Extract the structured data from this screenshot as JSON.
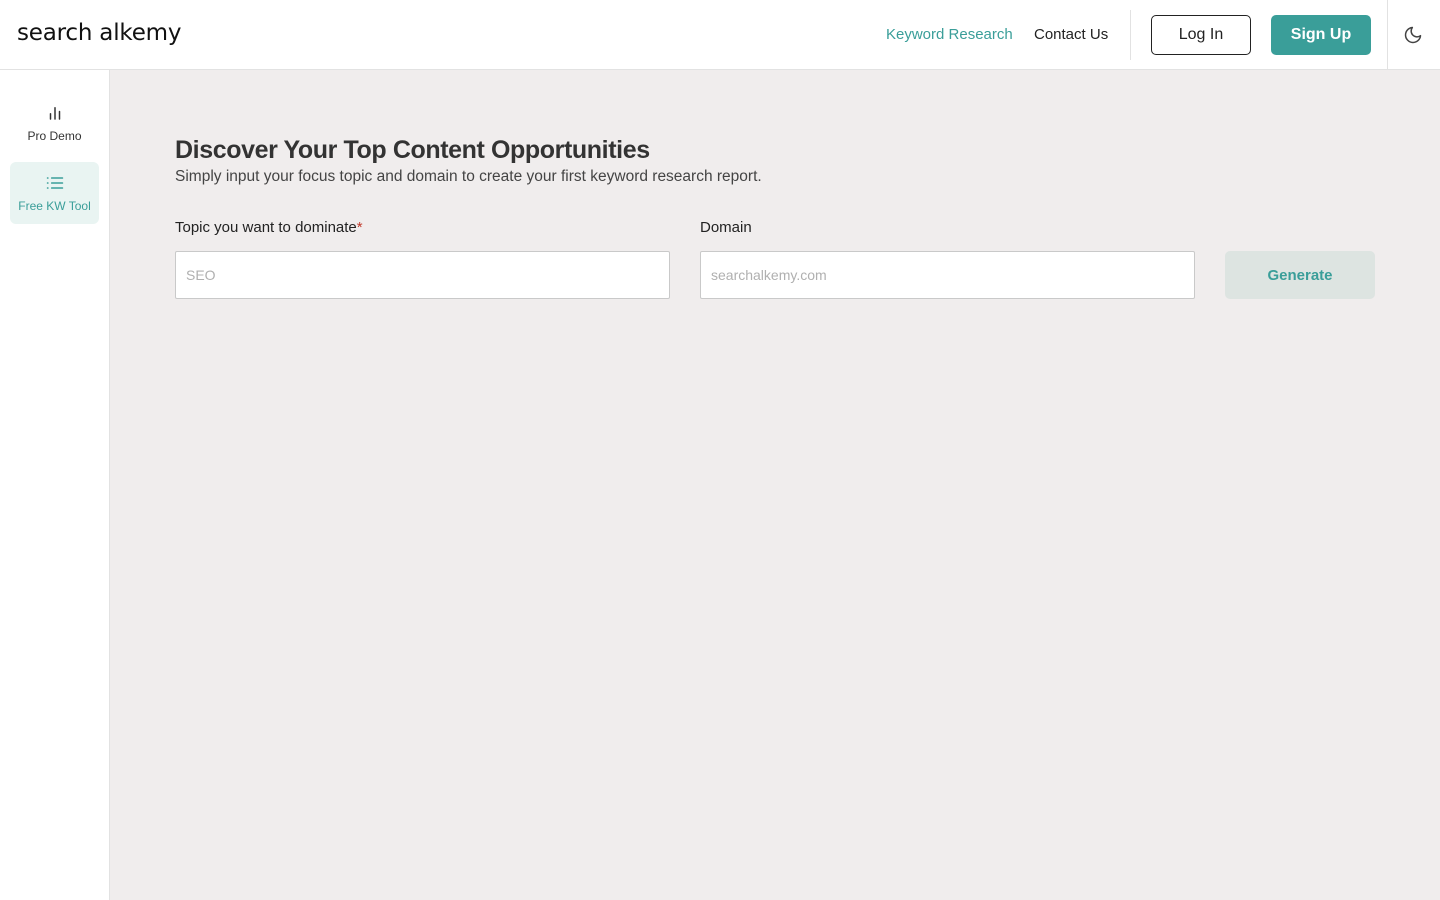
{
  "header": {
    "logo": "search alkemy",
    "nav": {
      "keyword_research": "Keyword Research",
      "contact_us": "Contact Us"
    },
    "login_label": "Log In",
    "signup_label": "Sign Up",
    "theme_icon": "moon-icon"
  },
  "sidebar": {
    "items": [
      {
        "label": "Pro Demo",
        "icon": "bar-chart-icon",
        "active": false
      },
      {
        "label": "Free KW Tool",
        "icon": "list-icon",
        "active": true
      }
    ]
  },
  "main": {
    "title": "Discover Your Top Content Opportunities",
    "subtitle": "Simply input your focus topic and domain to create your first keyword research report.",
    "topic_field": {
      "label": "Topic you want to dominate",
      "required_marker": "*",
      "value": "",
      "placeholder": "SEO"
    },
    "domain_field": {
      "label": "Domain",
      "value": "",
      "placeholder": "searchalkemy.com"
    },
    "generate_label": "Generate"
  },
  "colors": {
    "accent": "#3a9e99",
    "main_background": "#f0eded",
    "sidebar_active_background": "#e9f4f2",
    "generate_disabled_background": "#dde4e1",
    "required": "#c0392b"
  }
}
